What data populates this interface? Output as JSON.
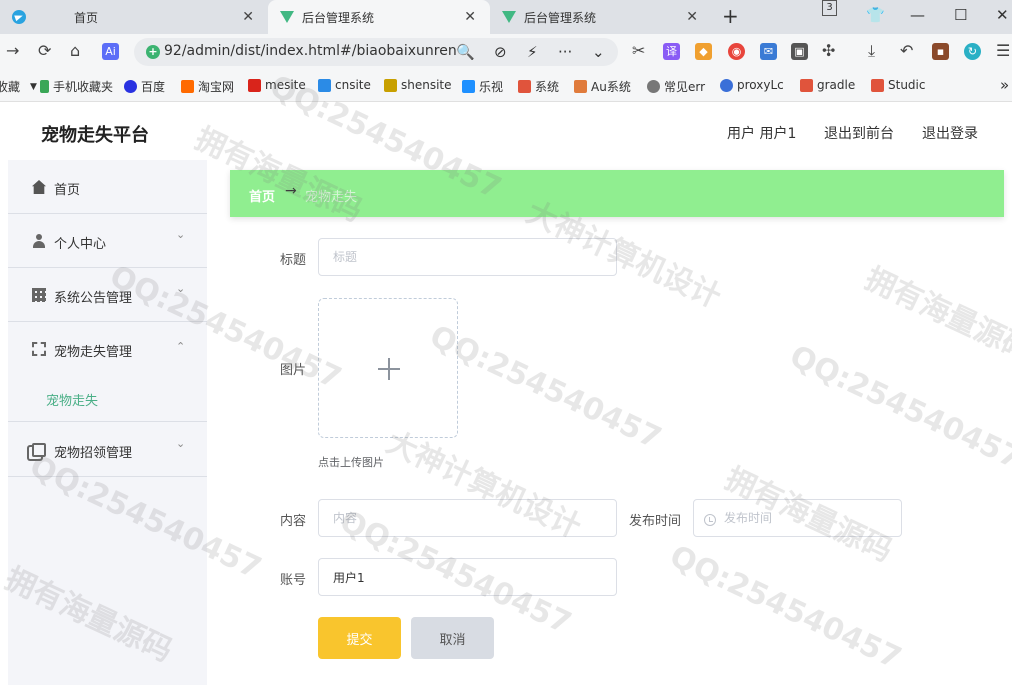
{
  "browser": {
    "tabs": [
      {
        "title": "首页",
        "favicon": "telegram-icon"
      },
      {
        "title": "后台管理系统",
        "favicon": "vue-icon"
      },
      {
        "title": "后台管理系统",
        "favicon": "vue-icon"
      }
    ],
    "new_tab_symbol": "+",
    "tab_counter": "3",
    "url": "92/admin/dist/index.html#/biaobaixunren",
    "bookmarks": [
      {
        "label": "收藏",
        "icon": "star-icon",
        "color": "#999999"
      },
      {
        "label": "手机收藏夹",
        "icon": "phone-icon",
        "color": "#3aa757"
      },
      {
        "label": "百度",
        "icon": "baidu-paw-icon",
        "color": "#2932e1"
      },
      {
        "label": "淘宝网",
        "icon": "taobao-icon",
        "color": "#ff6a00"
      },
      {
        "label": "mesite",
        "icon": "red-square-icon",
        "color": "#d9241b"
      },
      {
        "label": "cnsite",
        "icon": "blue-square-icon",
        "color": "#2b8be6"
      },
      {
        "label": "shensite",
        "icon": "grid-icon",
        "color": "#c8a000"
      },
      {
        "label": "乐视",
        "icon": "tv-icon",
        "color": "#1e90ff"
      },
      {
        "label": "系统",
        "icon": "c-icon",
        "color": "#e0543c"
      },
      {
        "label": "Au系统",
        "icon": "au-icon",
        "color": "#e07b3c"
      },
      {
        "label": "常见err",
        "icon": "globe-icon",
        "color": "#777777"
      },
      {
        "label": "proxyLc",
        "icon": "proxy-icon",
        "color": "#3a6fd8"
      },
      {
        "label": "gradle",
        "icon": "c-icon",
        "color": "#e0543c"
      },
      {
        "label": "Studic",
        "icon": "c-icon",
        "color": "#e0543c"
      }
    ],
    "more_bookmarks": "»"
  },
  "app": {
    "title": "宠物走失平台",
    "header_links": {
      "user": "用户 用户1",
      "front": "退出到前台",
      "logout": "退出登录"
    },
    "menu": [
      {
        "label": "首页",
        "icon": "home-icon"
      },
      {
        "label": "个人中心",
        "icon": "user-icon",
        "arrow": "⌄"
      },
      {
        "label": "系统公告管理",
        "icon": "grid-icon",
        "arrow": "⌄"
      },
      {
        "label": "宠物走失管理",
        "icon": "frame-icon",
        "arrow": "⌃",
        "submenu": [
          "宠物走失"
        ]
      },
      {
        "label": "宠物招领管理",
        "icon": "copy-icon",
        "arrow": "⌄"
      }
    ],
    "breadcrumb": {
      "home": "首页",
      "separator": "→",
      "current": "宠物走失"
    },
    "form": {
      "title_label": "标题",
      "title_placeholder": "标题",
      "image_label": "图片",
      "upload_tip": "点击上传图片",
      "content_label": "内容",
      "content_placeholder": "内容",
      "publish_time_label": "发布时间",
      "publish_time_placeholder": "发布时间",
      "account_label": "账号",
      "account_value": "用户1",
      "submit": "提交",
      "cancel": "取消"
    },
    "colors": {
      "breadcrumb_bg": "#90ee90",
      "submit_bg": "#f9c52d",
      "cancel_bg": "#d8dce3",
      "active_submenu": "#4aaf87",
      "sidebar_bg": "#f4f5f9"
    }
  },
  "watermarks": [
    "拥有海量源码",
    "大神计算机设计",
    "QQ:254540457"
  ]
}
